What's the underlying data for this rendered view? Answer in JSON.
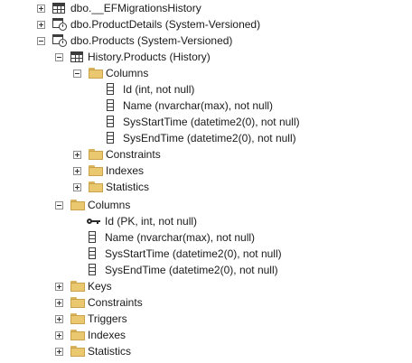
{
  "tree": {
    "nodes": [
      {
        "label": "dbo.__EFMigrationsHistory",
        "icon": "table-icon",
        "expander": "plus"
      },
      {
        "label": "dbo.ProductDetails (System-Versioned)",
        "icon": "versioned-table-icon",
        "expander": "plus"
      },
      {
        "label": "dbo.Products (System-Versioned)",
        "icon": "versioned-table-icon",
        "expander": "minus"
      },
      {
        "label": "History.Products (History)",
        "icon": "table-icon",
        "expander": "minus"
      },
      {
        "label": "Columns",
        "icon": "folder-icon",
        "expander": "minus"
      },
      {
        "label": "Id (int, not null)",
        "icon": "column-icon"
      },
      {
        "label": "Name (nvarchar(max), not null)",
        "icon": "column-icon"
      },
      {
        "label": "SysStartTime (datetime2(0), not null)",
        "icon": "column-icon"
      },
      {
        "label": "SysEndTime (datetime2(0), not null)",
        "icon": "column-icon"
      },
      {
        "label": "Constraints",
        "icon": "folder-icon",
        "expander": "plus"
      },
      {
        "label": "Indexes",
        "icon": "folder-icon",
        "expander": "plus"
      },
      {
        "label": "Statistics",
        "icon": "folder-icon",
        "expander": "plus"
      },
      {
        "label": "Columns",
        "icon": "folder-icon",
        "expander": "minus"
      },
      {
        "label": "Id (PK, int, not null)",
        "icon": "key-icon"
      },
      {
        "label": "Name (nvarchar(max), not null)",
        "icon": "column-icon"
      },
      {
        "label": "SysStartTime (datetime2(0), not null)",
        "icon": "column-icon"
      },
      {
        "label": "SysEndTime (datetime2(0), not null)",
        "icon": "column-icon"
      },
      {
        "label": "Keys",
        "icon": "folder-icon",
        "expander": "plus"
      },
      {
        "label": "Constraints",
        "icon": "folder-icon",
        "expander": "plus"
      },
      {
        "label": "Triggers",
        "icon": "folder-icon",
        "expander": "plus"
      },
      {
        "label": "Indexes",
        "icon": "folder-icon",
        "expander": "plus"
      },
      {
        "label": "Statistics",
        "icon": "folder-icon",
        "expander": "plus"
      }
    ]
  }
}
